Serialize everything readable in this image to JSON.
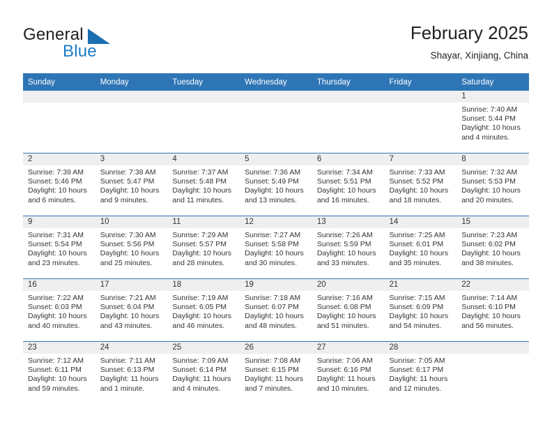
{
  "brand": {
    "name_part1": "General",
    "name_part2": "Blue",
    "logo_icon": "blue-triangle-logo"
  },
  "header": {
    "title": "February 2025",
    "subtitle": "Shayar, Xinjiang, China"
  },
  "weekdays": [
    "Sunday",
    "Monday",
    "Tuesday",
    "Wednesday",
    "Thursday",
    "Friday",
    "Saturday"
  ],
  "colors": {
    "header_blue": "#2e75b6",
    "daynum_strip": "#efefef",
    "brand_blue": "#1a7bc4",
    "text": "#333333"
  },
  "weeks": [
    [
      {
        "day": "",
        "sunrise": "",
        "sunset": "",
        "daylight1": "",
        "daylight2": "",
        "empty": true
      },
      {
        "day": "",
        "sunrise": "",
        "sunset": "",
        "daylight1": "",
        "daylight2": "",
        "empty": true
      },
      {
        "day": "",
        "sunrise": "",
        "sunset": "",
        "daylight1": "",
        "daylight2": "",
        "empty": true
      },
      {
        "day": "",
        "sunrise": "",
        "sunset": "",
        "daylight1": "",
        "daylight2": "",
        "empty": true
      },
      {
        "day": "",
        "sunrise": "",
        "sunset": "",
        "daylight1": "",
        "daylight2": "",
        "empty": true
      },
      {
        "day": "",
        "sunrise": "",
        "sunset": "",
        "daylight1": "",
        "daylight2": "",
        "empty": true
      },
      {
        "day": "1",
        "sunrise": "Sunrise: 7:40 AM",
        "sunset": "Sunset: 5:44 PM",
        "daylight1": "Daylight: 10 hours",
        "daylight2": "and 4 minutes.",
        "empty": false
      }
    ],
    [
      {
        "day": "2",
        "sunrise": "Sunrise: 7:39 AM",
        "sunset": "Sunset: 5:46 PM",
        "daylight1": "Daylight: 10 hours",
        "daylight2": "and 6 minutes.",
        "empty": false
      },
      {
        "day": "3",
        "sunrise": "Sunrise: 7:38 AM",
        "sunset": "Sunset: 5:47 PM",
        "daylight1": "Daylight: 10 hours",
        "daylight2": "and 9 minutes.",
        "empty": false
      },
      {
        "day": "4",
        "sunrise": "Sunrise: 7:37 AM",
        "sunset": "Sunset: 5:48 PM",
        "daylight1": "Daylight: 10 hours",
        "daylight2": "and 11 minutes.",
        "empty": false
      },
      {
        "day": "5",
        "sunrise": "Sunrise: 7:36 AM",
        "sunset": "Sunset: 5:49 PM",
        "daylight1": "Daylight: 10 hours",
        "daylight2": "and 13 minutes.",
        "empty": false
      },
      {
        "day": "6",
        "sunrise": "Sunrise: 7:34 AM",
        "sunset": "Sunset: 5:51 PM",
        "daylight1": "Daylight: 10 hours",
        "daylight2": "and 16 minutes.",
        "empty": false
      },
      {
        "day": "7",
        "sunrise": "Sunrise: 7:33 AM",
        "sunset": "Sunset: 5:52 PM",
        "daylight1": "Daylight: 10 hours",
        "daylight2": "and 18 minutes.",
        "empty": false
      },
      {
        "day": "8",
        "sunrise": "Sunrise: 7:32 AM",
        "sunset": "Sunset: 5:53 PM",
        "daylight1": "Daylight: 10 hours",
        "daylight2": "and 20 minutes.",
        "empty": false
      }
    ],
    [
      {
        "day": "9",
        "sunrise": "Sunrise: 7:31 AM",
        "sunset": "Sunset: 5:54 PM",
        "daylight1": "Daylight: 10 hours",
        "daylight2": "and 23 minutes.",
        "empty": false
      },
      {
        "day": "10",
        "sunrise": "Sunrise: 7:30 AM",
        "sunset": "Sunset: 5:56 PM",
        "daylight1": "Daylight: 10 hours",
        "daylight2": "and 25 minutes.",
        "empty": false
      },
      {
        "day": "11",
        "sunrise": "Sunrise: 7:29 AM",
        "sunset": "Sunset: 5:57 PM",
        "daylight1": "Daylight: 10 hours",
        "daylight2": "and 28 minutes.",
        "empty": false
      },
      {
        "day": "12",
        "sunrise": "Sunrise: 7:27 AM",
        "sunset": "Sunset: 5:58 PM",
        "daylight1": "Daylight: 10 hours",
        "daylight2": "and 30 minutes.",
        "empty": false
      },
      {
        "day": "13",
        "sunrise": "Sunrise: 7:26 AM",
        "sunset": "Sunset: 5:59 PM",
        "daylight1": "Daylight: 10 hours",
        "daylight2": "and 33 minutes.",
        "empty": false
      },
      {
        "day": "14",
        "sunrise": "Sunrise: 7:25 AM",
        "sunset": "Sunset: 6:01 PM",
        "daylight1": "Daylight: 10 hours",
        "daylight2": "and 35 minutes.",
        "empty": false
      },
      {
        "day": "15",
        "sunrise": "Sunrise: 7:23 AM",
        "sunset": "Sunset: 6:02 PM",
        "daylight1": "Daylight: 10 hours",
        "daylight2": "and 38 minutes.",
        "empty": false
      }
    ],
    [
      {
        "day": "16",
        "sunrise": "Sunrise: 7:22 AM",
        "sunset": "Sunset: 6:03 PM",
        "daylight1": "Daylight: 10 hours",
        "daylight2": "and 40 minutes.",
        "empty": false
      },
      {
        "day": "17",
        "sunrise": "Sunrise: 7:21 AM",
        "sunset": "Sunset: 6:04 PM",
        "daylight1": "Daylight: 10 hours",
        "daylight2": "and 43 minutes.",
        "empty": false
      },
      {
        "day": "18",
        "sunrise": "Sunrise: 7:19 AM",
        "sunset": "Sunset: 6:05 PM",
        "daylight1": "Daylight: 10 hours",
        "daylight2": "and 46 minutes.",
        "empty": false
      },
      {
        "day": "19",
        "sunrise": "Sunrise: 7:18 AM",
        "sunset": "Sunset: 6:07 PM",
        "daylight1": "Daylight: 10 hours",
        "daylight2": "and 48 minutes.",
        "empty": false
      },
      {
        "day": "20",
        "sunrise": "Sunrise: 7:16 AM",
        "sunset": "Sunset: 6:08 PM",
        "daylight1": "Daylight: 10 hours",
        "daylight2": "and 51 minutes.",
        "empty": false
      },
      {
        "day": "21",
        "sunrise": "Sunrise: 7:15 AM",
        "sunset": "Sunset: 6:09 PM",
        "daylight1": "Daylight: 10 hours",
        "daylight2": "and 54 minutes.",
        "empty": false
      },
      {
        "day": "22",
        "sunrise": "Sunrise: 7:14 AM",
        "sunset": "Sunset: 6:10 PM",
        "daylight1": "Daylight: 10 hours",
        "daylight2": "and 56 minutes.",
        "empty": false
      }
    ],
    [
      {
        "day": "23",
        "sunrise": "Sunrise: 7:12 AM",
        "sunset": "Sunset: 6:11 PM",
        "daylight1": "Daylight: 10 hours",
        "daylight2": "and 59 minutes.",
        "empty": false
      },
      {
        "day": "24",
        "sunrise": "Sunrise: 7:11 AM",
        "sunset": "Sunset: 6:13 PM",
        "daylight1": "Daylight: 11 hours",
        "daylight2": "and 1 minute.",
        "empty": false
      },
      {
        "day": "25",
        "sunrise": "Sunrise: 7:09 AM",
        "sunset": "Sunset: 6:14 PM",
        "daylight1": "Daylight: 11 hours",
        "daylight2": "and 4 minutes.",
        "empty": false
      },
      {
        "day": "26",
        "sunrise": "Sunrise: 7:08 AM",
        "sunset": "Sunset: 6:15 PM",
        "daylight1": "Daylight: 11 hours",
        "daylight2": "and 7 minutes.",
        "empty": false
      },
      {
        "day": "27",
        "sunrise": "Sunrise: 7:06 AM",
        "sunset": "Sunset: 6:16 PM",
        "daylight1": "Daylight: 11 hours",
        "daylight2": "and 10 minutes.",
        "empty": false
      },
      {
        "day": "28",
        "sunrise": "Sunrise: 7:05 AM",
        "sunset": "Sunset: 6:17 PM",
        "daylight1": "Daylight: 11 hours",
        "daylight2": "and 12 minutes.",
        "empty": false
      },
      {
        "day": "",
        "sunrise": "",
        "sunset": "",
        "daylight1": "",
        "daylight2": "",
        "empty": true
      }
    ]
  ]
}
